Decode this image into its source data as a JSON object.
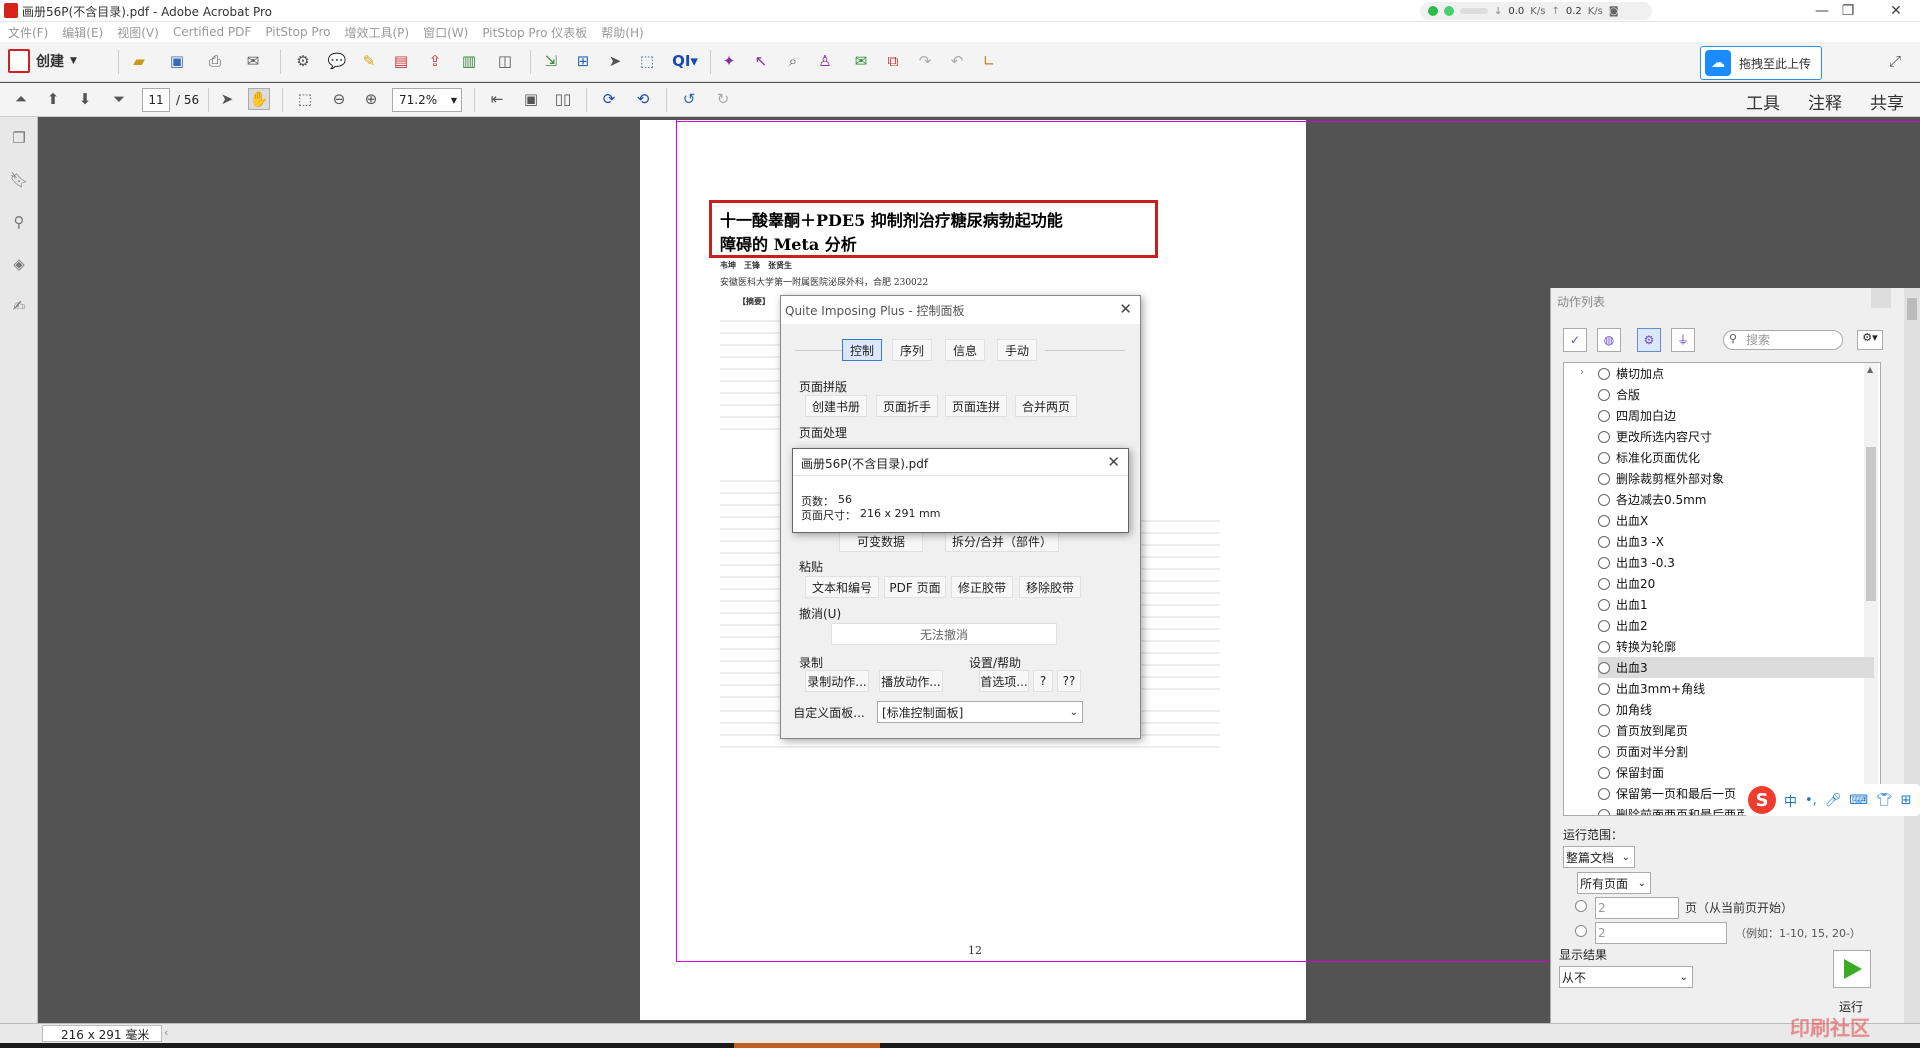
{
  "window": {
    "title": "画册56P(不含目录).pdf - Adobe Acrobat Pro",
    "min": "—",
    "max": "❐",
    "close": "✕"
  },
  "network": {
    "down": "0.0",
    "up": "0.2",
    "unit": "K/s"
  },
  "menu": [
    "文件(F)",
    "编辑(E)",
    "视图(V)",
    "Certified PDF",
    "PitStop Pro",
    "增效工具(P)",
    "窗口(W)",
    "PitStop Pro 仪表板",
    "帮助(H)"
  ],
  "toolbar": {
    "create_label": "创建",
    "upload_label": "拖拽至此上传"
  },
  "nav": {
    "page": "11",
    "total": "/ 56",
    "zoom": "71.2%"
  },
  "right_links": {
    "tools": "工具",
    "comment": "注释",
    "share": "共享"
  },
  "doc": {
    "title_line1": "十一酸睾酮＋PDE5 抑制剂治疗糖尿病勃起功能",
    "title_line2": "障碍的 Meta 分析",
    "authors": "韦坤　王锋　张贤生",
    "affiliation": "安徽医科大学第一附属医院泌尿外科，合肥 230022",
    "abstract_label": "【摘要】",
    "page_number": "12"
  },
  "qip": {
    "title": "Quite Imposing Plus - 控制面板",
    "tabs": [
      "控制",
      "序列",
      "信息",
      "手动"
    ],
    "page_layout": "页面拼版",
    "layout_buttons": [
      "创建书册",
      "页面折手",
      "页面连拼",
      "合并两页"
    ],
    "page_processing": "页面处理",
    "var_data": "可变数据",
    "split": "拆分/合并（部件）",
    "paste": "粘贴",
    "paste_buttons": [
      "文本和编号",
      "PDF 页面",
      "修正胶带",
      "移除胶带"
    ],
    "undo": "撤消(U)",
    "undo_button": "无法撤消",
    "record": "录制",
    "record_buttons": [
      "录制动作...",
      "播放动作..."
    ],
    "settings": "设置/帮助",
    "settings_buttons": [
      "首选项...",
      "?",
      "??"
    ],
    "custom_panel": "自定义面板...",
    "panel_select": "[标准控制面板]"
  },
  "info": {
    "title": "画册56P(不含目录).pdf",
    "pages_label": "页数：",
    "pages": "56",
    "size_label": "页面尺寸：",
    "size": "216 x 291 mm"
  },
  "actions": {
    "title": "动作列表",
    "search_placeholder": "搜索",
    "items": [
      "横切加点",
      "合版",
      "四周加白边",
      "更改所选内容尺寸",
      "标准化页面优化",
      "删除裁剪框外部对象",
      "各边减去0.5mm",
      "出血X",
      "出血3 -X",
      "出血3 -0.3",
      "出血20",
      "出血1",
      "出血2",
      "转换为轮廓",
      "出血3",
      "出血3mm+角线",
      "加角线",
      "首页放到尾页",
      "页面对半分割",
      "保留封面",
      "保留第一页和最后一页",
      "删除前面两页和最后两页"
    ],
    "selected": "出血3",
    "range_label": "运行范围：",
    "range_value": "整篇文档",
    "pages_value": "所有页面",
    "from_value": "2",
    "from_hint": "页（从当前页开始）",
    "to_value": "2",
    "to_hint": "（例如：1-10, 15, 20-）",
    "show_label": "显示结果",
    "show_value": "从不",
    "run_label": "运行"
  },
  "status": {
    "size": "216 x 291 毫米"
  },
  "ime": {
    "zh": "中",
    "punct": "•,"
  },
  "watermark": "印刷社区"
}
